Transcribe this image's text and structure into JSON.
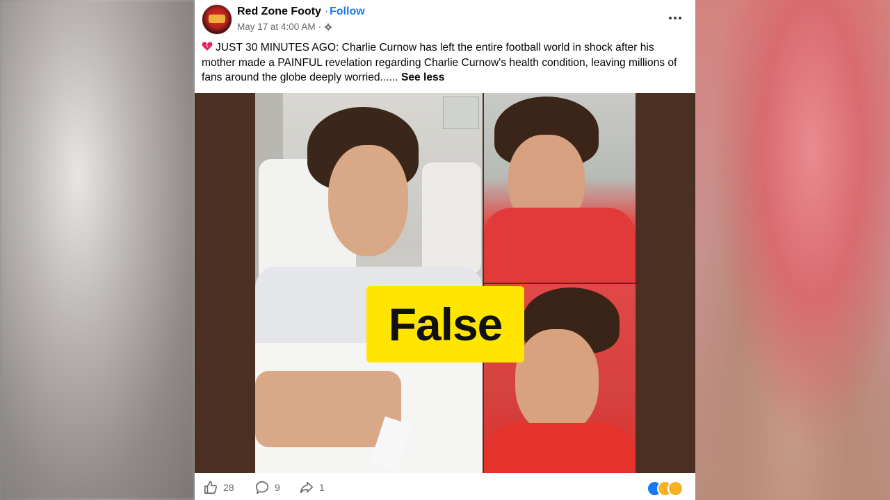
{
  "post": {
    "page_name": "Red Zone Footy",
    "separator": "·",
    "follow_label": "Follow",
    "timestamp": "May 17 at 4:00 AM",
    "body_text": "JUST 30 MINUTES AGO: Charlie Curnow has left the entire football world in shock after his mother made a PAINFUL revelation regarding Charlie Curnow's health condition, leaving millions of fans around the globe deeply worried......",
    "see_less_label": "See less"
  },
  "media": {
    "badge_text": "False",
    "badge_color": "#ffe500"
  },
  "footer": {
    "like_count": "28",
    "comment_count": "9",
    "share_count": "1"
  },
  "colors": {
    "accent": "#1877f2",
    "text": "#050505",
    "secondary": "#65676b"
  }
}
